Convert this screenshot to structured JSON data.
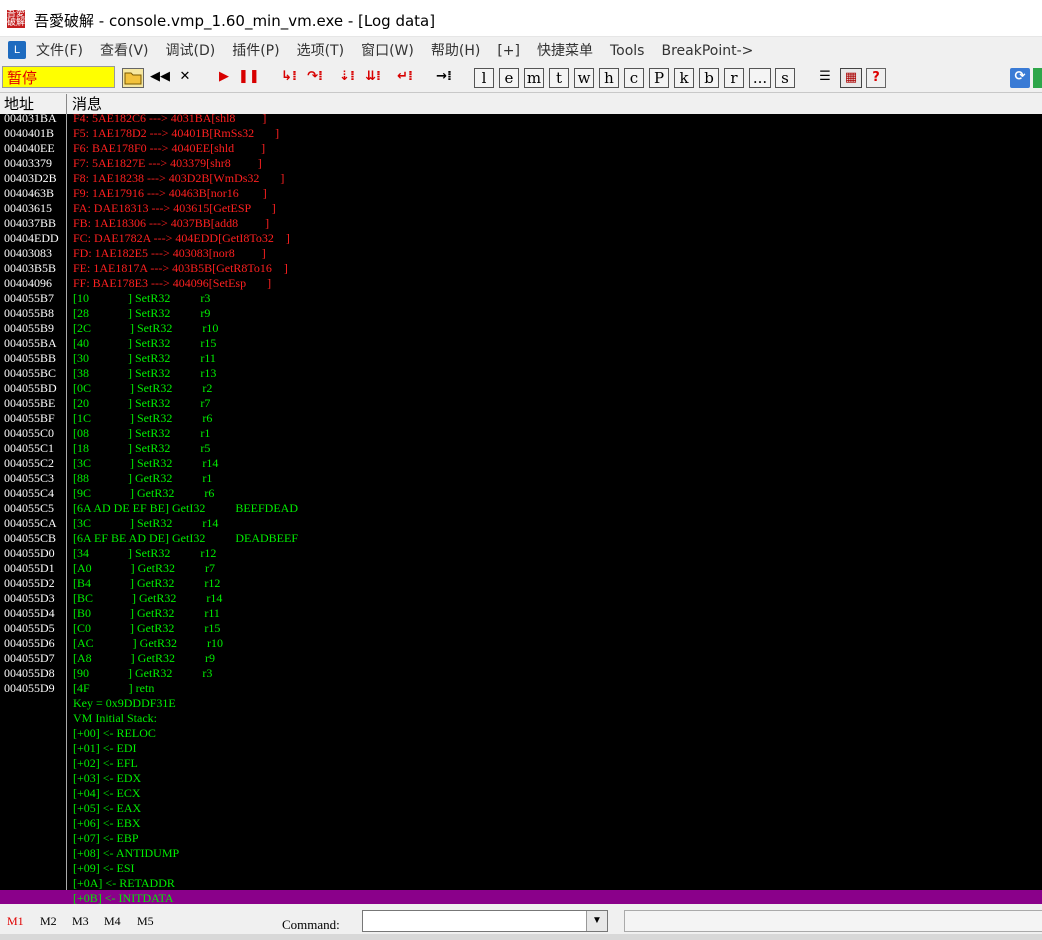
{
  "window": {
    "title": "吾愛破解 - console.vmp_1.60_min_vm.exe - [Log data]",
    "app_icon_text": "吾愛\n破解"
  },
  "menu": {
    "icon": "L",
    "items": [
      "文件(F)",
      "查看(V)",
      "调试(D)",
      "插件(P)",
      "选项(T)",
      "窗口(W)",
      "帮助(H)",
      "[+]",
      "快捷菜单",
      "Tools",
      "BreakPoint->"
    ]
  },
  "toolbar": {
    "status": "暂停",
    "letters": [
      "l",
      "e",
      "m",
      "t",
      "w",
      "h",
      "c",
      "P",
      "k",
      "b",
      "r",
      "...",
      "s"
    ],
    "help": "?"
  },
  "columns": {
    "address": "地址",
    "message": "消息"
  },
  "log_red": [
    {
      "addr": "004031BA",
      "msg": "F4: 5AE182C6 ---> 4031BA[shl8         ]"
    },
    {
      "addr": "0040401B",
      "msg": "F5: 1AE178D2 ---> 40401B[RmSs32       ]"
    },
    {
      "addr": "004040EE",
      "msg": "F6: BAE178F0 ---> 4040EE[shld         ]"
    },
    {
      "addr": "00403379",
      "msg": "F7: 5AE1827E ---> 403379[shr8         ]"
    },
    {
      "addr": "00403D2B",
      "msg": "F8: 1AE18238 ---> 403D2B[WmDs32       ]"
    },
    {
      "addr": "0040463B",
      "msg": "F9: 1AE17916 ---> 40463B[nor16        ]"
    },
    {
      "addr": "00403615",
      "msg": "FA: DAE18313 ---> 403615[GetESP       ]"
    },
    {
      "addr": "004037BB",
      "msg": "FB: 1AE18306 ---> 4037BB[add8         ]"
    },
    {
      "addr": "00404EDD",
      "msg": "FC: DAE1782A ---> 404EDD[GetI8To32    ]"
    },
    {
      "addr": "00403083",
      "msg": "FD: 1AE182E5 ---> 403083[nor8         ]"
    },
    {
      "addr": "00403B5B",
      "msg": "FE: 1AE1817A ---> 403B5B[GetR8To16    ]"
    },
    {
      "addr": "00404096",
      "msg": "FF: BAE178E3 ---> 404096[SetEsp       ]"
    }
  ],
  "log_green": [
    {
      "addr": "004055B7",
      "msg": "[10             ] SetR32          r3"
    },
    {
      "addr": "004055B8",
      "msg": "[28             ] SetR32          r9"
    },
    {
      "addr": "004055B9",
      "msg": "[2C             ] SetR32          r10"
    },
    {
      "addr": "004055BA",
      "msg": "[40             ] SetR32          r15"
    },
    {
      "addr": "004055BB",
      "msg": "[30             ] SetR32          r11"
    },
    {
      "addr": "004055BC",
      "msg": "[38             ] SetR32          r13"
    },
    {
      "addr": "004055BD",
      "msg": "[0C             ] SetR32          r2"
    },
    {
      "addr": "004055BE",
      "msg": "[20             ] SetR32          r7"
    },
    {
      "addr": "004055BF",
      "msg": "[1C             ] SetR32          r6"
    },
    {
      "addr": "004055C0",
      "msg": "[08             ] SetR32          r1"
    },
    {
      "addr": "004055C1",
      "msg": "[18             ] SetR32          r5"
    },
    {
      "addr": "004055C2",
      "msg": "[3C             ] SetR32          r14"
    },
    {
      "addr": "004055C3",
      "msg": "[88             ] GetR32          r1"
    },
    {
      "addr": "004055C4",
      "msg": "[9C             ] GetR32          r6"
    },
    {
      "addr": "004055C5",
      "msg": "[6A AD DE EF BE] GetI32          BEEFDEAD"
    },
    {
      "addr": "004055CA",
      "msg": "[3C             ] SetR32          r14"
    },
    {
      "addr": "004055CB",
      "msg": "[6A EF BE AD DE] GetI32          DEADBEEF"
    },
    {
      "addr": "004055D0",
      "msg": "[34             ] SetR32          r12"
    },
    {
      "addr": "004055D1",
      "msg": "[A0             ] GetR32          r7"
    },
    {
      "addr": "004055D2",
      "msg": "[B4             ] GetR32          r12"
    },
    {
      "addr": "004055D3",
      "msg": "[BC             ] GetR32          r14"
    },
    {
      "addr": "004055D4",
      "msg": "[B0             ] GetR32          r11"
    },
    {
      "addr": "004055D5",
      "msg": "[C0             ] GetR32          r15"
    },
    {
      "addr": "004055D6",
      "msg": "[AC             ] GetR32          r10"
    },
    {
      "addr": "004055D7",
      "msg": "[A8             ] GetR32          r9"
    },
    {
      "addr": "004055D8",
      "msg": "[90             ] GetR32          r3"
    },
    {
      "addr": "004055D9",
      "msg": "[4F             ] retn"
    }
  ],
  "log_tail": [
    "Key = 0x9DDDF31E",
    "VM Initial Stack:",
    "[+00] <- RELOC",
    "[+01] <- EDI",
    "[+02] <- EFL",
    "[+03] <- EDX",
    "[+04] <- ECX",
    "[+05] <- EAX",
    "[+06] <- EBX",
    "[+07] <- EBP",
    "[+08] <- ANTIDUMP",
    "[+09] <- ESI",
    "[+0A] <- RETADDR",
    "[+0B] <- INITDATA"
  ],
  "bottom": {
    "tabs": [
      "M1",
      "M2",
      "M3",
      "M4",
      "M5"
    ],
    "command_label": "Command:",
    "dropdown_glyph": "▼"
  },
  "colors": {
    "log_background": "#000000",
    "log_red": "#ff2020",
    "log_green": "#00ee00",
    "highlight": "#8a008a",
    "status_bg": "#ffff00"
  }
}
